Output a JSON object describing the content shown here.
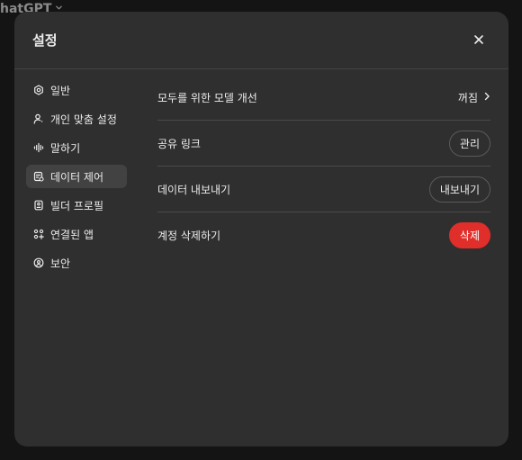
{
  "background": {
    "app_title": "hatGPT"
  },
  "modal": {
    "title": "설정"
  },
  "sidebar": {
    "items": [
      {
        "label": "일반",
        "icon": "gear-icon"
      },
      {
        "label": "개인 맞춤 설정",
        "icon": "person-icon"
      },
      {
        "label": "말하기",
        "icon": "waveform-icon"
      },
      {
        "label": "데이터 제어",
        "icon": "database-icon",
        "active": true
      },
      {
        "label": "빌더 프로필",
        "icon": "profile-card-icon"
      },
      {
        "label": "연결된 앱",
        "icon": "apps-grid-icon"
      },
      {
        "label": "보안",
        "icon": "shield-icon"
      }
    ]
  },
  "settings": {
    "improve_model": {
      "label": "모두를 위한 모델 개선",
      "value": "꺼짐"
    },
    "shared_links": {
      "label": "공유 링크",
      "button": "관리"
    },
    "export_data": {
      "label": "데이터 내보내기",
      "button": "내보내기"
    },
    "delete_account": {
      "label": "계정 삭제하기",
      "button": "삭제"
    }
  },
  "colors": {
    "modal_bg": "#2f2f2f",
    "active_nav_bg": "#424242",
    "danger": "#e02e2a",
    "divider": "#4a4a4a"
  }
}
